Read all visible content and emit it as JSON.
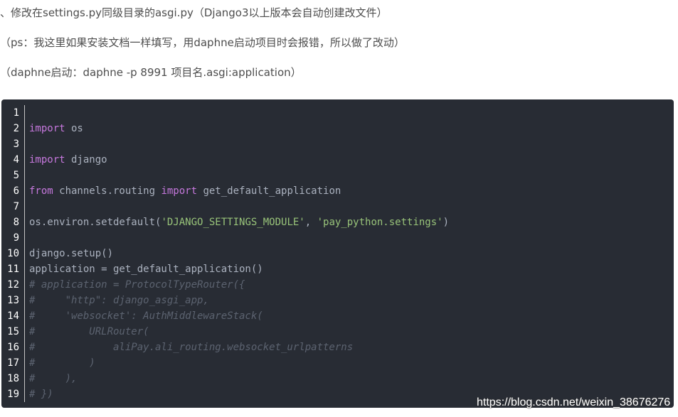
{
  "paragraphs": [
    "、修改在settings.py同级目录的asgi.py（Django3以上版本会自动创建改文件）",
    "（ps：我这里如果安装文档一样填写，用daphne启动项目时会报错，所以做了改动）",
    "（daphne启动：daphne -p 8991 项目名.asgi:application）"
  ],
  "code_block": {
    "language": "python",
    "lines": [
      {
        "n": "1",
        "tokens": []
      },
      {
        "n": "2",
        "tokens": [
          {
            "t": "keyword",
            "v": "import"
          },
          {
            "t": "plain",
            "v": " os"
          }
        ]
      },
      {
        "n": "3",
        "tokens": []
      },
      {
        "n": "4",
        "tokens": [
          {
            "t": "keyword",
            "v": "import"
          },
          {
            "t": "plain",
            "v": " django"
          }
        ]
      },
      {
        "n": "5",
        "tokens": []
      },
      {
        "n": "6",
        "tokens": [
          {
            "t": "keyword",
            "v": "from"
          },
          {
            "t": "plain",
            "v": " channels.routing "
          },
          {
            "t": "keyword",
            "v": "import"
          },
          {
            "t": "plain",
            "v": " get_default_application"
          }
        ]
      },
      {
        "n": "7",
        "tokens": []
      },
      {
        "n": "8",
        "tokens": [
          {
            "t": "plain",
            "v": "os.environ.setdefault("
          },
          {
            "t": "string",
            "v": "'DJANGO_SETTINGS_MODULE'"
          },
          {
            "t": "plain",
            "v": ", "
          },
          {
            "t": "string",
            "v": "'pay_python.settings'"
          },
          {
            "t": "plain",
            "v": ")"
          }
        ]
      },
      {
        "n": "9",
        "tokens": []
      },
      {
        "n": "10",
        "tokens": [
          {
            "t": "plain",
            "v": "django.setup()"
          }
        ]
      },
      {
        "n": "11",
        "tokens": [
          {
            "t": "plain",
            "v": "application = get_default_application()"
          }
        ]
      },
      {
        "n": "12",
        "tokens": [
          {
            "t": "comment",
            "v": "# application = ProtocolTypeRouter({"
          }
        ]
      },
      {
        "n": "13",
        "tokens": [
          {
            "t": "comment",
            "v": "#     \"http\": django_asgi_app,"
          }
        ]
      },
      {
        "n": "14",
        "tokens": [
          {
            "t": "comment",
            "v": "#     'websocket': AuthMiddlewareStack("
          }
        ]
      },
      {
        "n": "15",
        "tokens": [
          {
            "t": "comment",
            "v": "#         URLRouter("
          }
        ]
      },
      {
        "n": "16",
        "tokens": [
          {
            "t": "comment",
            "v": "#             aliPay.ali_routing.websocket_urlpatterns"
          }
        ]
      },
      {
        "n": "17",
        "tokens": [
          {
            "t": "comment",
            "v": "#         )"
          }
        ]
      },
      {
        "n": "18",
        "tokens": [
          {
            "t": "comment",
            "v": "#     ),"
          }
        ]
      },
      {
        "n": "19",
        "tokens": [
          {
            "t": "comment",
            "v": "# })"
          }
        ]
      }
    ]
  },
  "watermark": "https://blog.csdn.net/weixin_38676276",
  "colors": {
    "code_background": "#282c34",
    "keyword": "#c678dd",
    "string": "#98c379",
    "comment": "#5c6370",
    "plain": "#abb2bf",
    "paragraph_text": "#4d4d4d"
  }
}
